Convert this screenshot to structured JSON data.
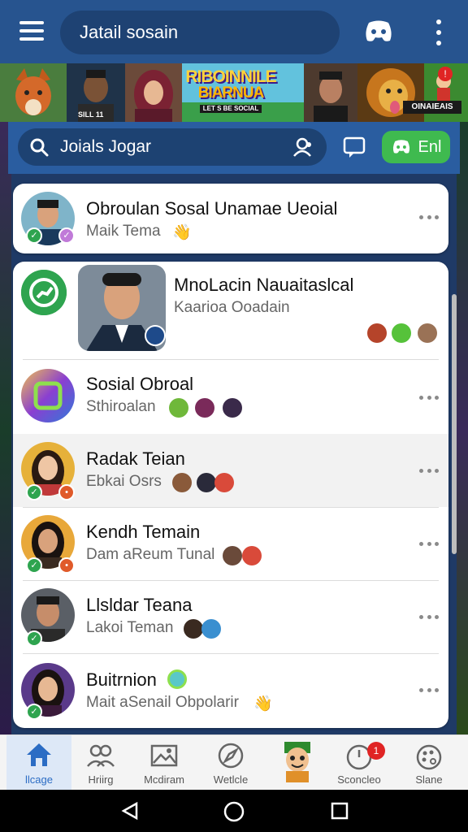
{
  "app": {
    "title": "Jatail sosain",
    "accent": "#27548f",
    "join_color": "#3fba4f"
  },
  "banner": {
    "logo_line1": "RIBOINNILE",
    "logo_line2": "BIARNUA",
    "logo_line3": "LET S BE SOCIAL",
    "tile_text": "SILL 11",
    "right_tag": "OINAIEAIS",
    "badge": "!"
  },
  "search": {
    "placeholder": "Joials Jogar"
  },
  "actions": {
    "join_label": "Enl"
  },
  "rows": [
    {
      "name": "Obroulan Sosal Unamae Ueoial",
      "sub": "Maik Tema",
      "emoji": "👋",
      "verified": true
    },
    {
      "name": "MnoLacin Nauaitaslcal",
      "sub": "Kaarioa Ooadain",
      "verified": false
    },
    {
      "name": "Sosial Obroal",
      "sub": "Sthiroalan",
      "verified": false
    },
    {
      "name": "Radak Teian",
      "sub": "Ebkai Osrs",
      "verified": true
    },
    {
      "name": "Kendh Temain",
      "sub": "Dam aReum Tunal",
      "verified": true
    },
    {
      "name": "Llsldar Teana",
      "sub": "Lakoi Teman",
      "verified": true
    },
    {
      "name": "Buitrnion",
      "sub": "Mait aSenail Obpolarir",
      "emoji": "👋",
      "verified": true
    }
  ],
  "bottom_nav": [
    {
      "label": "llcage",
      "icon": "home-icon",
      "active": true
    },
    {
      "label": "Hriirg",
      "icon": "people-icon",
      "active": false
    },
    {
      "label": "Mcdiram",
      "icon": "image-icon",
      "active": false
    },
    {
      "label": "Wetlcle",
      "icon": "compass-icon",
      "active": false
    },
    {
      "label": "",
      "icon": "avatar-icon",
      "active": false
    },
    {
      "label": "Sconcleo",
      "icon": "clock-icon",
      "active": false,
      "badge": "1"
    },
    {
      "label": "Slane",
      "icon": "palette-icon",
      "active": false
    }
  ]
}
